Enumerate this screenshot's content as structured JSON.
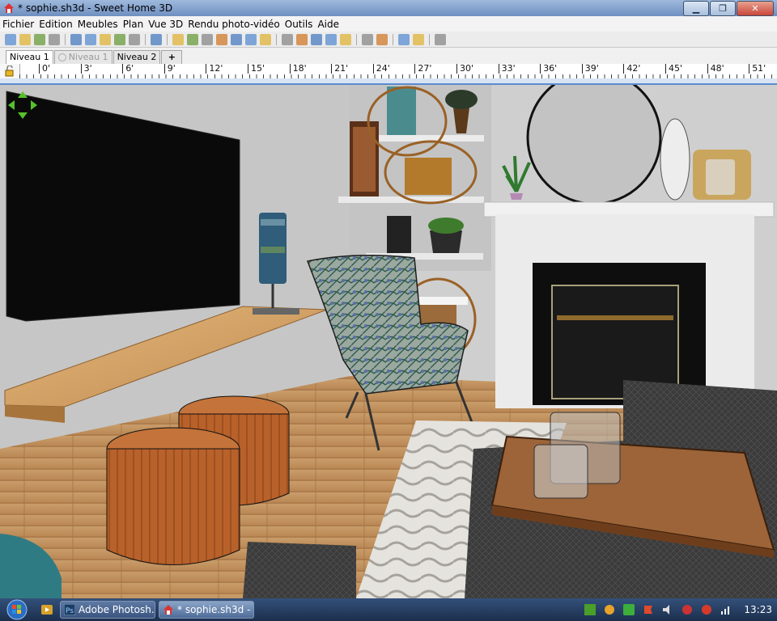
{
  "window": {
    "title": "* sophie.sh3d - Sweet Home 3D"
  },
  "menu": [
    "Fichier",
    "Edition",
    "Meubles",
    "Plan",
    "Vue 3D",
    "Rendu photo-vidéo",
    "Outils",
    "Aide"
  ],
  "toolbar": {
    "icons": [
      "new-icon",
      "open-icon",
      "save-icon",
      "preferences-icon",
      "sep",
      "undo-icon",
      "redo-icon",
      "cut-icon",
      "copy-icon",
      "paste-icon",
      "sep",
      "add-furniture-icon",
      "sep",
      "select-icon",
      "pan-icon",
      "create-walls-icon",
      "create-rooms-icon",
      "create-polylines-icon",
      "create-dimensions-icon",
      "add-text-icon",
      "sep",
      "text-style-icon",
      "text-bold-icon",
      "text-italic-icon",
      "text-larger-icon",
      "text-smaller-icon",
      "sep",
      "zoom-in-icon",
      "zoom-out-icon",
      "sep",
      "create-photo-icon",
      "create-video-icon",
      "sep",
      "help-icon"
    ]
  },
  "levels": {
    "tabs": [
      {
        "label": "Niveau 1",
        "state": "active"
      },
      {
        "label": "Niveau 1",
        "state": "disabled"
      },
      {
        "label": "Niveau 2",
        "state": "normal"
      }
    ],
    "add_label": "+"
  },
  "ruler": {
    "marks": [
      "0'",
      "3'",
      "6'",
      "9'",
      "12'",
      "15'",
      "18'",
      "21'",
      "24'",
      "27'",
      "30'",
      "33'",
      "36'",
      "39'",
      "42'",
      "45'",
      "48'",
      "51'"
    ]
  },
  "taskbar": {
    "items": [
      {
        "label": "Adobe Photosh...",
        "active": false
      },
      {
        "label": "* sophie.sh3d - ...",
        "active": true
      }
    ],
    "clock": "13:23"
  }
}
